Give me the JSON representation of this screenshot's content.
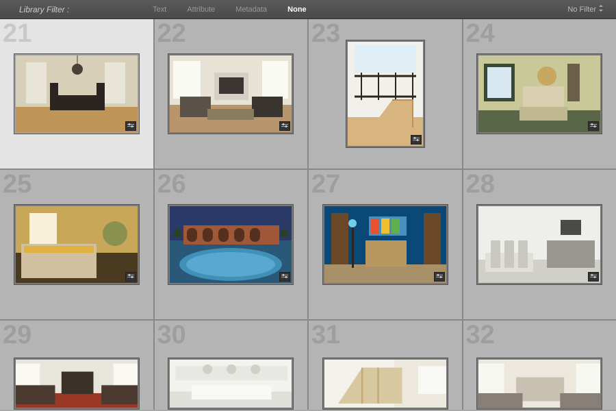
{
  "toolbar": {
    "label": "Library Filter :",
    "tabs": [
      {
        "label": "Text",
        "active": false
      },
      {
        "label": "Attribute",
        "active": false
      },
      {
        "label": "Metadata",
        "active": false
      },
      {
        "label": "None",
        "active": true
      }
    ],
    "no_filter_label": "No Filter"
  },
  "grid": {
    "selected_index": 0,
    "cells": [
      {
        "num": "21",
        "desc": "dining-room"
      },
      {
        "num": "22",
        "desc": "living-room"
      },
      {
        "num": "23",
        "desc": "staircase",
        "tall": true
      },
      {
        "num": "24",
        "desc": "bedroom-green"
      },
      {
        "num": "25",
        "desc": "bedroom-warm"
      },
      {
        "num": "26",
        "desc": "pool-dusk"
      },
      {
        "num": "27",
        "desc": "blue-living-room"
      },
      {
        "num": "28",
        "desc": "white-living-room"
      },
      {
        "num": "29",
        "desc": "living-room-red",
        "partial": true
      },
      {
        "num": "30",
        "desc": "kitchen-white",
        "partial": true
      },
      {
        "num": "31",
        "desc": "staircase-white",
        "partial": true
      },
      {
        "num": "32",
        "desc": "living-room-large",
        "partial": true
      }
    ]
  },
  "icons": {
    "adjustments": "adjustments-icon",
    "dropdown": "dropdown-icon"
  }
}
